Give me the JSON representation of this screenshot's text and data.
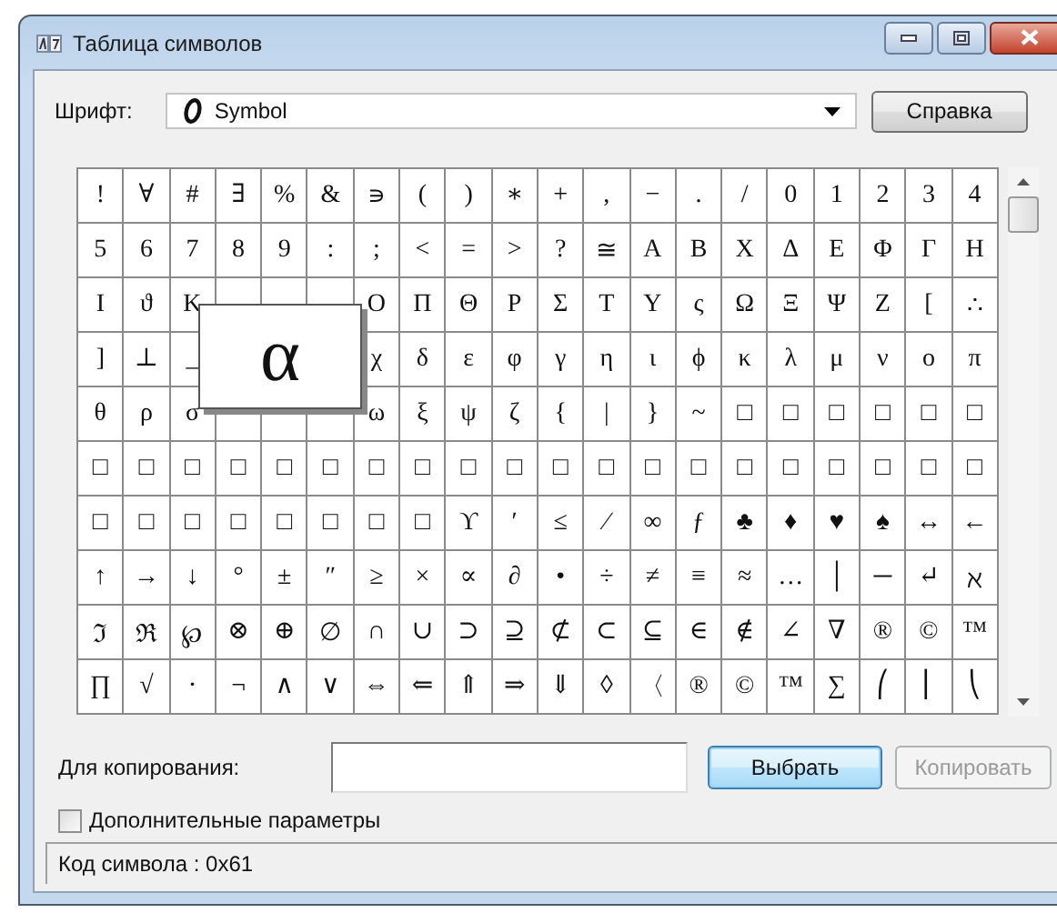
{
  "window": {
    "title": "Таблица символов"
  },
  "font": {
    "label": "Шрифт:",
    "value": "Symbol"
  },
  "help_button": {
    "label": "Справка"
  },
  "grid": {
    "magnifier": "α",
    "rows": [
      [
        "!",
        "∀",
        "#",
        "∃",
        "%",
        "&",
        "∍",
        "(",
        ")",
        "∗",
        "+",
        ",",
        "−",
        ".",
        "/",
        "0",
        "1",
        "2",
        "3",
        "4"
      ],
      [
        "5",
        "6",
        "7",
        "8",
        "9",
        ":",
        ";",
        "<",
        "=",
        ">",
        "?",
        "≅",
        "Α",
        "Β",
        "Χ",
        "Δ",
        "Ε",
        "Φ",
        "Γ",
        "Η"
      ],
      [
        "Ι",
        "ϑ",
        "Κ",
        null,
        null,
        null,
        "Ο",
        "Π",
        "Θ",
        "Ρ",
        "Σ",
        "Τ",
        "Υ",
        "ς",
        "Ω",
        "Ξ",
        "Ψ",
        "Ζ",
        "[",
        "∴"
      ],
      [
        "]",
        "⊥",
        "_",
        null,
        null,
        null,
        "χ",
        "δ",
        "ε",
        "φ",
        "γ",
        "η",
        "ι",
        "ϕ",
        "κ",
        "λ",
        "μ",
        "ν",
        "ο",
        "π"
      ],
      [
        "θ",
        "ρ",
        "σ",
        null,
        null,
        null,
        "ω",
        "ξ",
        "ψ",
        "ζ",
        "{",
        "|",
        "}",
        "~",
        "□",
        "□",
        "□",
        "□",
        "□",
        "□"
      ],
      [
        "□",
        "□",
        "□",
        "□",
        "□",
        "□",
        "□",
        "□",
        "□",
        "□",
        "□",
        "□",
        "□",
        "□",
        "□",
        "□",
        "□",
        "□",
        "□",
        "□"
      ],
      [
        "□",
        "□",
        "□",
        "□",
        "□",
        "□",
        "□",
        "□",
        "ϒ",
        "′",
        "≤",
        "⁄",
        "∞",
        "ƒ",
        "♣",
        "♦",
        "♥",
        "♠",
        "↔",
        "←"
      ],
      [
        "↑",
        "→",
        "↓",
        "°",
        "±",
        "″",
        "≥",
        "×",
        "∝",
        "∂",
        "•",
        "÷",
        "≠",
        "≡",
        "≈",
        "…",
        "│",
        "─",
        "↵",
        "ℵ"
      ],
      [
        "ℑ",
        "ℜ",
        "℘",
        "⊗",
        "⊕",
        "∅",
        "∩",
        "∪",
        "⊃",
        "⊇",
        "⊄",
        "⊂",
        "⊆",
        "∈",
        "∉",
        "∠",
        "∇",
        "®",
        "©",
        "™"
      ],
      [
        "∏",
        "√",
        "⋅",
        "¬",
        "∧",
        "∨",
        "⇔",
        "⇐",
        "⇑",
        "⇒",
        "⇓",
        "◊",
        "〈",
        "®",
        "©",
        "™",
        "∑",
        "⎛",
        "⎜",
        "⎝"
      ]
    ]
  },
  "copy": {
    "label": "Для копирования:"
  },
  "buttons": [
    {
      "label": "Выбрать",
      "focused": true,
      "disabled": false
    },
    {
      "label": "Копировать",
      "focused": false,
      "disabled": true
    }
  ],
  "advanced": {
    "label": "Дополнительные параметры",
    "checked": false
  },
  "status_bar": {
    "text": "Код символа : 0x61"
  }
}
